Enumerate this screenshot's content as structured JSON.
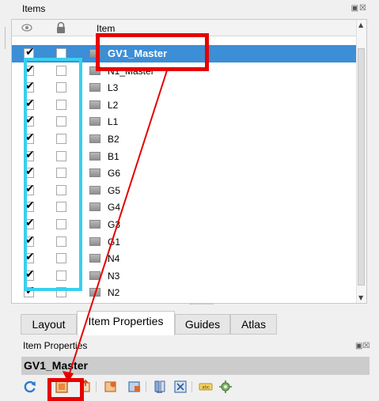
{
  "items_dock": {
    "title": "Items",
    "dock_buttons": "▣☒"
  },
  "tree": {
    "header_item": "Item",
    "rows": [
      {
        "name": "GV1_Master",
        "visible": true,
        "locked": false,
        "selected": true
      },
      {
        "name": "N1_Master",
        "visible": true,
        "locked": false,
        "selected": false
      },
      {
        "name": "L3",
        "visible": true,
        "locked": false,
        "selected": false
      },
      {
        "name": "L2",
        "visible": true,
        "locked": false,
        "selected": false
      },
      {
        "name": "L1",
        "visible": true,
        "locked": false,
        "selected": false
      },
      {
        "name": "B2",
        "visible": true,
        "locked": false,
        "selected": false
      },
      {
        "name": "B1",
        "visible": true,
        "locked": false,
        "selected": false
      },
      {
        "name": "G6",
        "visible": true,
        "locked": false,
        "selected": false
      },
      {
        "name": "G5",
        "visible": true,
        "locked": false,
        "selected": false
      },
      {
        "name": "G4",
        "visible": true,
        "locked": false,
        "selected": false
      },
      {
        "name": "G3",
        "visible": true,
        "locked": false,
        "selected": false
      },
      {
        "name": "G1",
        "visible": true,
        "locked": false,
        "selected": false
      },
      {
        "name": "N4",
        "visible": true,
        "locked": false,
        "selected": false
      },
      {
        "name": "N3",
        "visible": true,
        "locked": false,
        "selected": false
      },
      {
        "name": "N2",
        "visible": true,
        "locked": false,
        "selected": false
      }
    ],
    "check_glyph": "✔",
    "scroll_up": "▲",
    "scroll_down": "▼"
  },
  "tabs": [
    {
      "label": "Layout",
      "active": false
    },
    {
      "label": "Item Properties",
      "active": true
    },
    {
      "label": "Guides",
      "active": false
    },
    {
      "label": "Atlas",
      "active": false
    }
  ],
  "properties": {
    "title": "Item Properties",
    "dock_buttons": "▣☒",
    "item_name": "GV1_Master"
  },
  "toolbar": {
    "icons": [
      "refresh-icon",
      "map-item-icon",
      "move-content-icon",
      "add-item-icon",
      "update-item-icon",
      "table-icon",
      "zoom-to-item-icon",
      "label-icon",
      "settings-gear-icon"
    ],
    "label_icon_text": "abc"
  },
  "colors": {
    "selection": "#3c8ed6",
    "annotation_red": "#e60000",
    "annotation_cyan": "#38d0ee"
  }
}
